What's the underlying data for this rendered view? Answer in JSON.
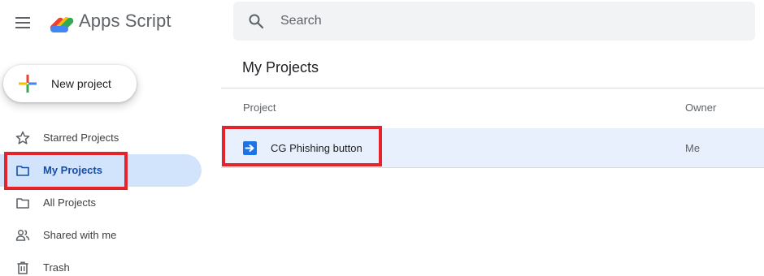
{
  "app": {
    "title": "Apps Script",
    "menu_icon": "hamburger-menu-icon",
    "logo_icon": "apps-script-logo"
  },
  "search": {
    "placeholder": "Search",
    "icon": "search-icon"
  },
  "sidebar": {
    "new_button_label": "New project",
    "items": [
      {
        "label": "Starred Projects",
        "icon": "star-icon",
        "active": false
      },
      {
        "label": "My Projects",
        "icon": "folder-icon",
        "active": true
      },
      {
        "label": "All Projects",
        "icon": "folder-icon",
        "active": false
      },
      {
        "label": "Shared with me",
        "icon": "people-icon",
        "active": false
      },
      {
        "label": "Trash",
        "icon": "trash-icon",
        "active": false
      }
    ]
  },
  "main": {
    "title": "My Projects",
    "columns": [
      "Project",
      "Owner"
    ],
    "projects": [
      {
        "name": "CG Phishing button",
        "owner": "Me",
        "icon": "apps-script-file-icon"
      }
    ]
  },
  "colors": {
    "active_nav_bg": "#d2e3fc",
    "selected_row_bg": "#e8f0fe",
    "annotation_red": "#e4232b",
    "script_icon_blue": "#1a73e8"
  }
}
